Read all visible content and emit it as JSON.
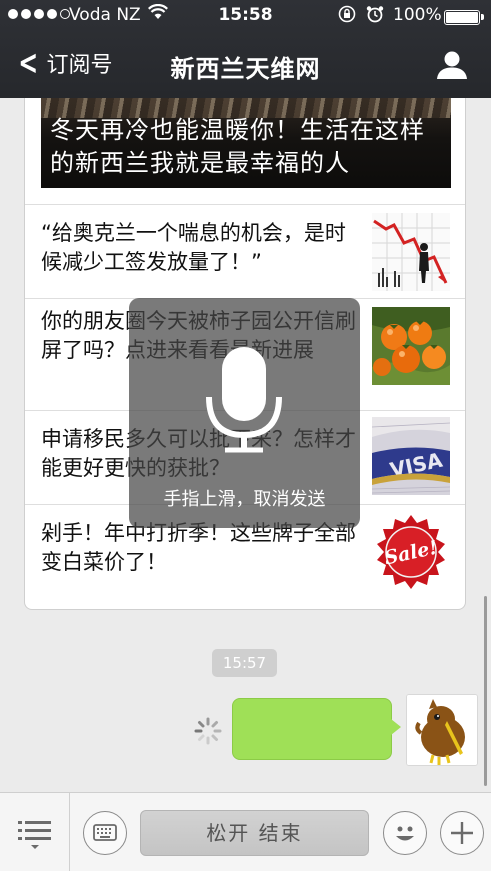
{
  "status_bar": {
    "carrier": "Voda NZ",
    "time": "15:58",
    "battery": "100%"
  },
  "nav": {
    "back_label": "订阅号",
    "title": "新西兰天维网"
  },
  "articles": {
    "hero_title": "冬天再冷也能温暖你！生活在这样的新西兰我就是最幸福的人",
    "items": [
      {
        "title": "“给奥克兰一个喘息的机会，是时候减少工签发放量了！”",
        "thumb": "chart-decline-image"
      },
      {
        "title": "你的朋友圈今天被柿子园公开信刷屏了吗？点进来看看最新进展",
        "thumb": "persimmons-image"
      },
      {
        "title": "申请移民多久可以批下来？怎样才能更好更快的获批？",
        "thumb": "visa-card-image"
      },
      {
        "title": "剁手！年中打折季！这些牌子全部变白菜价了！",
        "thumb": "sale-badge-image"
      }
    ]
  },
  "chat": {
    "timestamp": "15:57"
  },
  "voice_overlay": {
    "hint": "手指上滑，取消发送"
  },
  "toolbar": {
    "hold_label": "松开 结束"
  },
  "colors": {
    "nav_bg": "#2a2c30",
    "bubble_green": "#9fe057",
    "chat_bg": "#ebebeb"
  }
}
